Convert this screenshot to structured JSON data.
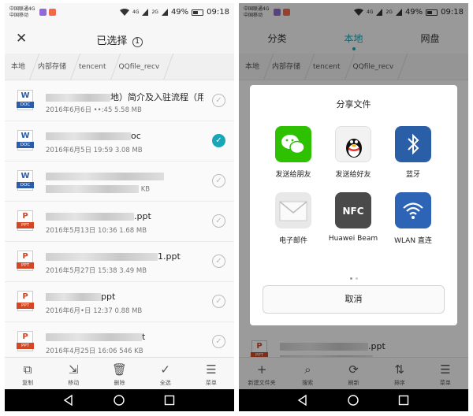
{
  "status": {
    "carrier_line1": "中国联通4G",
    "carrier_line2": "中国移动",
    "battery": "49%",
    "time": "09:18",
    "net1": "4G",
    "net2": "2G"
  },
  "left": {
    "header": {
      "title": "已选择",
      "count": "1"
    },
    "breadcrumbs": [
      "本地",
      "内部存储",
      "tencent",
      "QQfile_recv"
    ],
    "files": [
      {
        "type": "doc",
        "letter": "W",
        "tag": "DOC",
        "name_visible": "地）简介及入驻流程（用…",
        "meta_visible": "2016年6月6日 ••:45 5.58 MB",
        "checked": false
      },
      {
        "type": "doc",
        "letter": "W",
        "tag": "DOC",
        "name_visible": "oc",
        "meta_visible": "2016年6月5日 19:59 3.08 MB",
        "checked": true
      },
      {
        "type": "doc",
        "letter": "W",
        "tag": "DOC",
        "name_visible": "",
        "meta_visible": "KB",
        "checked": false
      },
      {
        "type": "ppt",
        "letter": "P",
        "tag": "PPT",
        "name_visible": ".ppt",
        "meta_visible": "2016年5月13日 10:36 1.68 MB",
        "checked": false
      },
      {
        "type": "ppt",
        "letter": "P",
        "tag": "PPT",
        "name_visible": "1.ppt",
        "meta_visible": "2016年5月27日 15:38 3.49 MB",
        "checked": false
      },
      {
        "type": "ppt",
        "letter": "P",
        "tag": "PPT",
        "name_visible": "ppt",
        "meta_visible": "2016年6月•日 12:37 0.88 MB",
        "checked": false
      },
      {
        "type": "ppt",
        "letter": "P",
        "tag": "PPT",
        "name_visible": "t",
        "meta_visible": "2016年4月25日 16:06 546 KB",
        "checked": false
      }
    ],
    "toolbar": [
      {
        "label": "复制",
        "icon": "copy-icon",
        "glyph": "⧉"
      },
      {
        "label": "移动",
        "icon": "move-icon",
        "glyph": "⇲"
      },
      {
        "label": "删除",
        "icon": "trash-icon",
        "glyph": "🗑"
      },
      {
        "label": "全选",
        "icon": "select-all-icon",
        "glyph": "✓"
      },
      {
        "label": "菜单",
        "icon": "menu-icon",
        "glyph": "☰"
      }
    ]
  },
  "right": {
    "tabs": [
      "分类",
      "本地",
      "网盘"
    ],
    "active_tab": 1,
    "breadcrumbs": [
      "本地",
      "内部存储",
      "tencent",
      "QQfile_recv"
    ],
    "behind_file": {
      "letter": "P",
      "tag": "PPT",
      "name_visible": ".ppt"
    },
    "dialog": {
      "title": "分享文件",
      "apps": [
        {
          "label": "发送给朋友",
          "icon": "wechat-icon"
        },
        {
          "label": "发送给好友",
          "icon": "qq-icon"
        },
        {
          "label": "蓝牙",
          "icon": "bluetooth-icon"
        },
        {
          "label": "电子邮件",
          "icon": "email-icon"
        },
        {
          "label": "Huawei Beam",
          "icon": "nfc-icon"
        },
        {
          "label": "WLAN 直连",
          "icon": "wifi-direct-icon"
        }
      ],
      "cancel": "取消"
    },
    "toolbar": [
      {
        "label": "新建文件夹",
        "icon": "plus-icon",
        "glyph": "+"
      },
      {
        "label": "搜索",
        "icon": "search-icon",
        "glyph": "⌕"
      },
      {
        "label": "刷新",
        "icon": "refresh-icon",
        "glyph": "⟳"
      },
      {
        "label": "排序",
        "icon": "sort-icon",
        "glyph": "⇅"
      },
      {
        "label": "菜单",
        "icon": "menu-icon",
        "glyph": "☰"
      }
    ]
  },
  "colors": {
    "accent": "#1aa6b7",
    "word": "#2a5caa",
    "ppt": "#d24726"
  }
}
